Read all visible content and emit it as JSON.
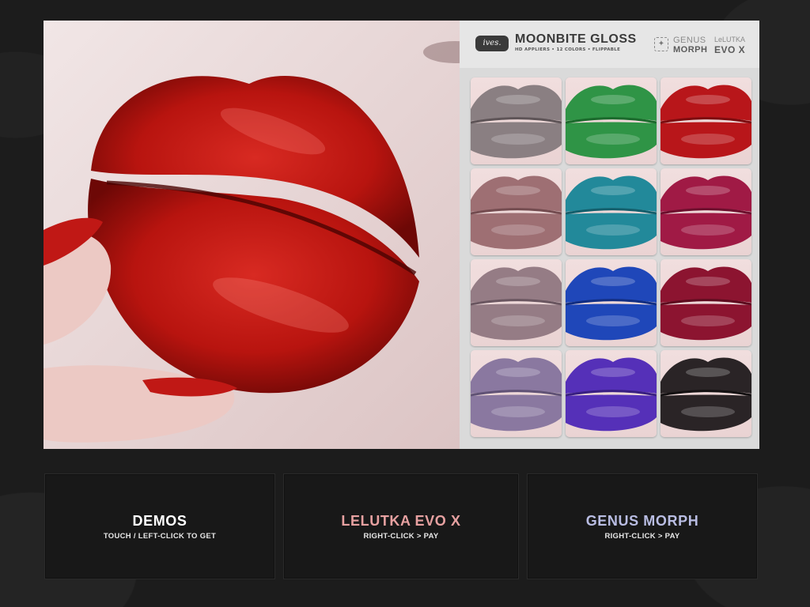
{
  "board": {
    "brand": "ives.",
    "product_title": "MOONBITE GLOSS",
    "product_subtitle": "HD APPLIERS  •  12 COLORS  •  FLIPPABLE",
    "compat": {
      "genus": "GENUS",
      "morph": "MORPH",
      "lelutka": "LeLUTKA",
      "evox": "EVO X"
    },
    "hero_color": "#b8140f",
    "swatches": [
      {
        "color": "#8a7f82",
        "dark": "#5e5457"
      },
      {
        "color": "#2f9446",
        "dark": "#1b6a2c"
      },
      {
        "color": "#b8161a",
        "dark": "#7d0c0f"
      },
      {
        "color": "#9e6f73",
        "dark": "#744c50"
      },
      {
        "color": "#22899a",
        "dark": "#145f6c"
      },
      {
        "color": "#a01a45",
        "dark": "#6d0f2d"
      },
      {
        "color": "#957c85",
        "dark": "#6a5660"
      },
      {
        "color": "#1f47b9",
        "dark": "#122e82"
      },
      {
        "color": "#8c1430",
        "dark": "#5e0c1f"
      },
      {
        "color": "#8a78a0",
        "dark": "#605275"
      },
      {
        "color": "#5530b8",
        "dark": "#391f82"
      },
      {
        "color": "#2a2426",
        "dark": "#141112"
      }
    ]
  },
  "buttons": {
    "demos": {
      "title": "DEMOS",
      "subtitle": "TOUCH / LEFT-CLICK TO GET",
      "color": "#ffffff"
    },
    "lelutka": {
      "title": "LELUTKA EVO X",
      "subtitle": "RIGHT-CLICK > PAY",
      "color": "#e7a1a1"
    },
    "genus": {
      "title": "GENUS MORPH",
      "subtitle": "RIGHT-CLICK > PAY",
      "color": "#b9bde3"
    }
  }
}
